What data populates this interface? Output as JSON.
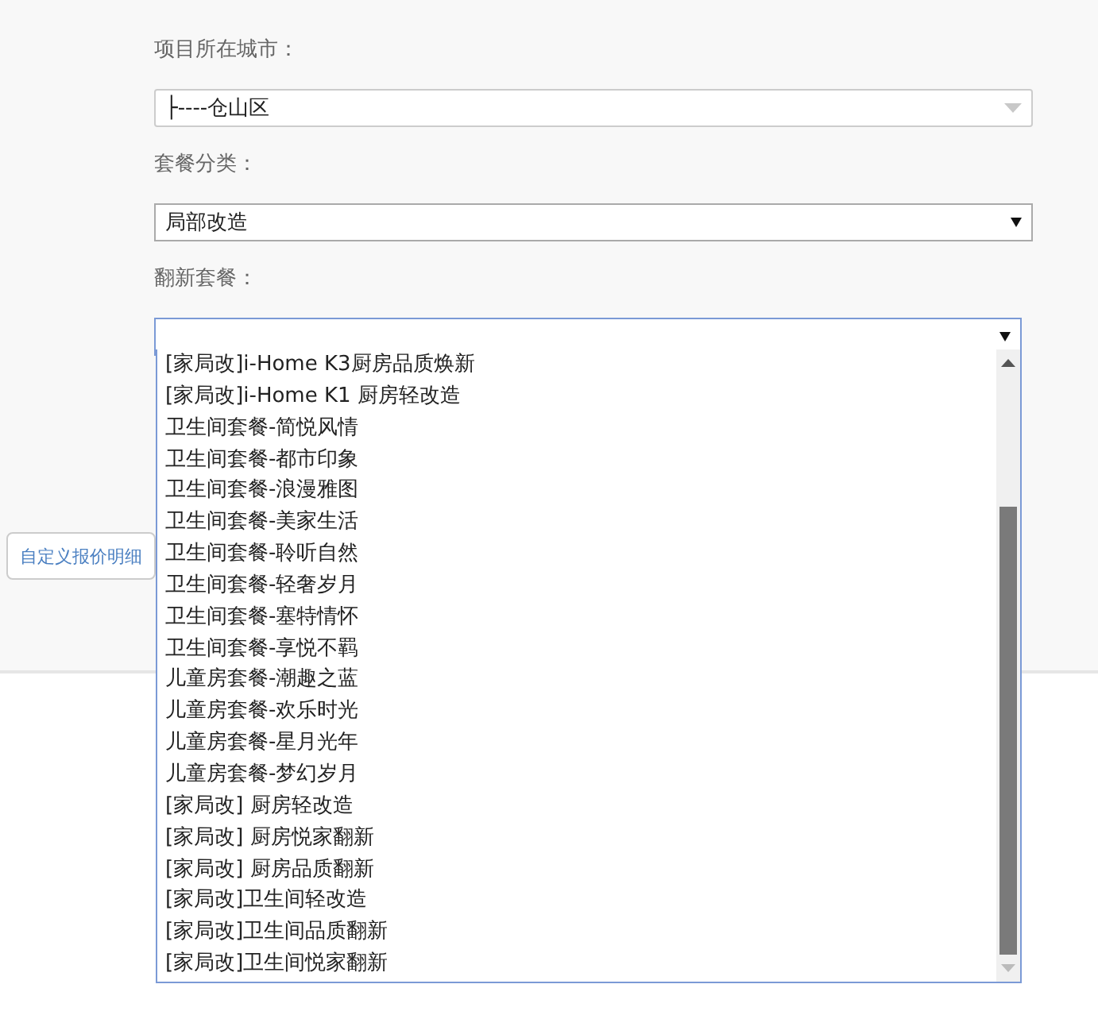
{
  "form": {
    "fields": [
      {
        "label": "项目所在城市：",
        "value": "├----仓山区",
        "kind": "combo",
        "focused": false
      },
      {
        "label": "套餐分类：",
        "value": "局部改造",
        "kind": "select",
        "focused": false
      },
      {
        "label": "翻新套餐：",
        "kind": "select",
        "focused": true
      }
    ]
  },
  "button": "自定义报价明细",
  "dropdown": {
    "options": [
      {
        "label": "[家局改]i-Home K3厨房品质焕新",
        "selected": false
      },
      {
        "label": "[家局改]i-Home K1 厨房轻改造",
        "selected": false
      },
      {
        "label": "卫生间套餐-简悦风情",
        "selected": false
      },
      {
        "label": "卫生间套餐-都市印象",
        "selected": false
      },
      {
        "label": "卫生间套餐-浪漫雅图",
        "selected": false
      },
      {
        "label": "卫生间套餐-美家生活",
        "selected": false
      },
      {
        "label": "卫生间套餐-聆听自然",
        "selected": false
      },
      {
        "label": "卫生间套餐-轻奢岁月",
        "selected": false
      },
      {
        "label": "卫生间套餐-塞特情怀",
        "selected": false
      },
      {
        "label": "卫生间套餐-享悦不羁",
        "selected": false
      },
      {
        "label": "儿童房套餐-潮趣之蓝",
        "selected": false
      },
      {
        "label": "儿童房套餐-欢乐时光",
        "selected": false
      },
      {
        "label": "儿童房套餐-星月光年",
        "selected": false
      },
      {
        "label": "儿童房套餐-梦幻岁月",
        "selected": false
      },
      {
        "label": "[家局改] 厨房轻改造",
        "selected": false
      },
      {
        "label": "[家局改] 厨房悦家翻新",
        "selected": false
      },
      {
        "label": "[家局改] 厨房品质翻新",
        "selected": false
      },
      {
        "label": "[家局改]卫生间轻改造",
        "selected": false
      },
      {
        "label": "[家局改]卫生间品质翻新",
        "selected": false
      },
      {
        "label": "[家局改]卫生间悦家翻新",
        "selected": false
      }
    ]
  }
}
